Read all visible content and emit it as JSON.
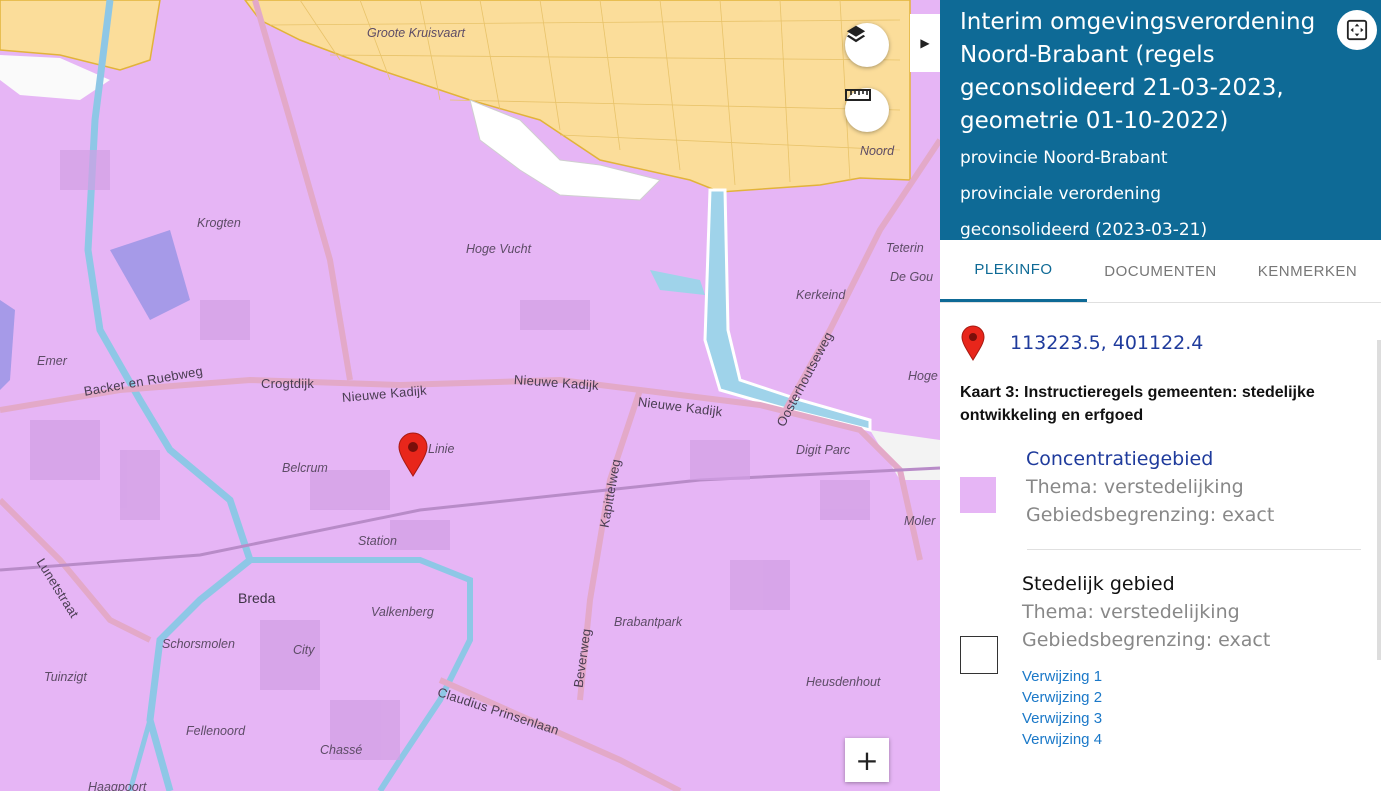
{
  "map": {
    "place_labels": [
      {
        "id": "groote-kruisvaart",
        "text": "Groote Kruisvaart"
      },
      {
        "id": "noord",
        "text": "Noord"
      },
      {
        "id": "krogten",
        "text": "Krogten"
      },
      {
        "id": "hoge-vucht",
        "text": "Hoge Vucht"
      },
      {
        "id": "teteringen",
        "text": "Teterin"
      },
      {
        "id": "de-gouw",
        "text": "De Gou"
      },
      {
        "id": "kerkeind",
        "text": "Kerkeind"
      },
      {
        "id": "emer",
        "text": "Emer"
      },
      {
        "id": "hoge",
        "text": "Hoge"
      },
      {
        "id": "linie",
        "text": "Linie"
      },
      {
        "id": "belcrum",
        "text": "Belcrum"
      },
      {
        "id": "digit-parc",
        "text": "Digit Parc"
      },
      {
        "id": "station",
        "text": "Station"
      },
      {
        "id": "moler",
        "text": "Moler"
      },
      {
        "id": "breda",
        "text": "Breda"
      },
      {
        "id": "valkenberg",
        "text": "Valkenberg"
      },
      {
        "id": "brabantpark",
        "text": "Brabantpark"
      },
      {
        "id": "schorsmolen",
        "text": "Schorsmolen"
      },
      {
        "id": "city",
        "text": "City"
      },
      {
        "id": "tuinzigt",
        "text": "Tuinzigt"
      },
      {
        "id": "heusdenhout",
        "text": "Heusdenhout"
      },
      {
        "id": "fellenoord",
        "text": "Fellenoord"
      },
      {
        "id": "chasse",
        "text": "Chassé"
      },
      {
        "id": "haagpoort",
        "text": "Haagpoort"
      }
    ],
    "road_labels": [
      {
        "id": "backer-en-ruebweg",
        "text": "Backer en Ruebweg"
      },
      {
        "id": "crogtdijk",
        "text": "Crogtdijk"
      },
      {
        "id": "nieuwe-kadijk-1",
        "text": "Nieuwe Kadijk"
      },
      {
        "id": "nieuwe-kadijk-2",
        "text": "Nieuwe Kadijk"
      },
      {
        "id": "nieuwe-kadijk-3",
        "text": "Nieuwe Kadijk"
      },
      {
        "id": "oosterhoutseweg",
        "text": "Oosterhoutseweg"
      },
      {
        "id": "kapittelweg",
        "text": "Kapittelweg"
      },
      {
        "id": "lunetstraat",
        "text": "Lunetstraat"
      },
      {
        "id": "beverweg",
        "text": "Beverweg"
      },
      {
        "id": "claudius-prinsenlaan",
        "text": "Claudius Prinsenlaan"
      }
    ],
    "zoom_in_label": "+",
    "colors": {
      "stedelijk_area": "#e6b5f5",
      "rural_area": "#fbdd9a",
      "water": "#9fd3ea",
      "marker": "#e8261b"
    }
  },
  "controls": {
    "layers_icon": "layers-icon",
    "measure_icon": "ruler-icon",
    "collapse_icon": "chevron-right-icon",
    "expand_icon": "fullscreen-icon"
  },
  "panel": {
    "title": "Interim omgevingsverordening Noord-Brabant (regels geconsolideerd 21-03-2023, geometrie 01-10-2022)",
    "subtitle_lines": [
      "provincie Noord-Brabant",
      "provinciale verordening",
      "geconsolideerd (2023-03-21)"
    ],
    "tabs": [
      "PLEKINFO",
      "DOCUMENTEN",
      "KENMERKEN"
    ],
    "active_tab": "PLEKINFO",
    "coordinates": "113223.5, 401122.4",
    "kaart_title": "Kaart 3: Instructieregels gemeenten: stedelijke ontwikkeling en erfgoed",
    "entries": [
      {
        "title": "Concentratiegebied",
        "thema": "Thema: verstedelijking",
        "begrenzing": "Gebiedsbegrenzing: exact",
        "swatch_color": "#e6b5f5"
      },
      {
        "title": "Stedelijk gebied",
        "thema": "Thema: verstedelijking",
        "begrenzing": "Gebiedsbegrenzing: exact",
        "swatch_color": "#ffffff",
        "references": [
          "Verwijzing 1",
          "Verwijzing 2",
          "Verwijzing 3",
          "Verwijzing 4"
        ]
      }
    ]
  }
}
